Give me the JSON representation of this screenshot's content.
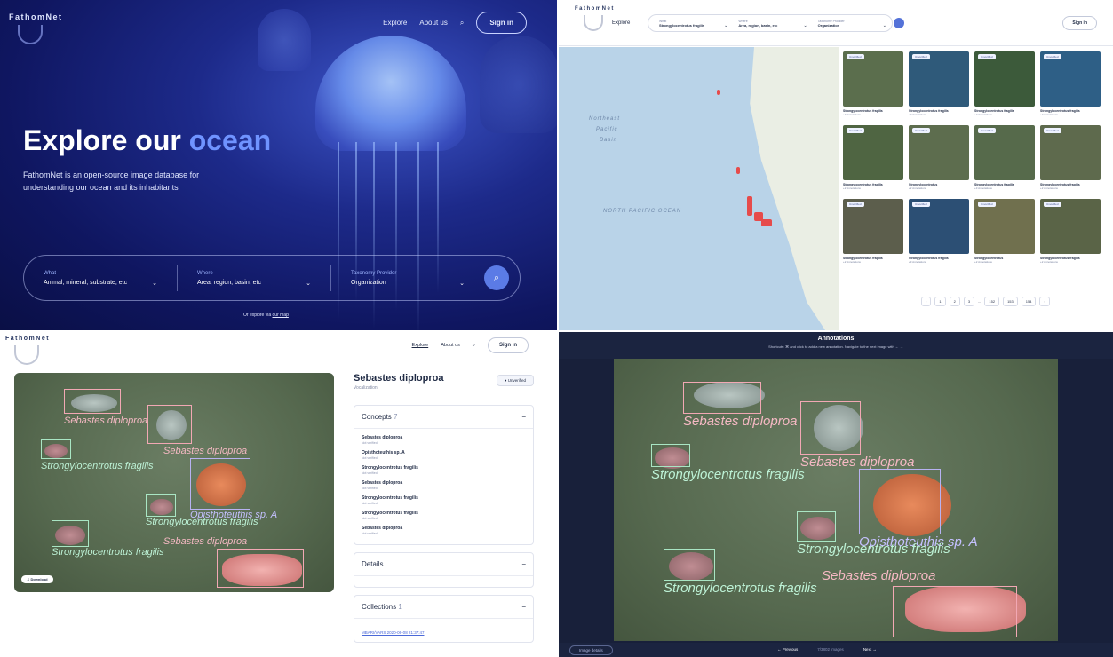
{
  "brand": "FathomNet",
  "hero": {
    "nav": {
      "explore": "Explore",
      "about": "About us",
      "sign_in": "Sign in"
    },
    "title_main": "Explore our ",
    "title_accent": "ocean",
    "subtitle": "FathomNet is an open-source image database for understanding our ocean and its inhabitants",
    "search": {
      "what_label": "What",
      "what_placeholder": "Animal, mineral, substrate, etc",
      "where_label": "Where",
      "where_placeholder": "Area, region, basin, etc",
      "taxonomy_label": "Taxonomy Provider",
      "taxonomy_value": "Organization"
    },
    "footer_prefix": "Or explore via ",
    "footer_link": "our map"
  },
  "explore": {
    "nav_explore": "Explore",
    "search": {
      "what_label": "What",
      "what_value": "Strongylocentrotus fragilis",
      "where_label": "Where",
      "where_value": "Area, region, basin, etc",
      "taxonomy_label": "Taxonomy Provider",
      "taxonomy_value": "Organization"
    },
    "sign_in": "Sign in",
    "map_labels": {
      "northeast": "Northeast",
      "pacific": "Pacific",
      "basin": "Basin",
      "ocean": "NORTH PACIFIC OCEAN"
    },
    "results": [
      {
        "tag": "Unverified",
        "name": "Strongylocentrotus fragilis",
        "meta": "+3 Annotations",
        "color": "#5b6e4d"
      },
      {
        "tag": "Unverified",
        "name": "Strongylocentrotus fragilis",
        "meta": "+2 Annotations",
        "color": "#2f5a7a"
      },
      {
        "tag": "Unverified",
        "name": "Strongylocentrotus fragilis",
        "meta": "+2 Annotations",
        "color": "#3c5a3a"
      },
      {
        "tag": "Unverified",
        "name": "Strongylocentrotus fragilis",
        "meta": "+2 Annotations",
        "color": "#2e5f86"
      },
      {
        "tag": "Unverified",
        "name": "Strongylocentrotus fragilis",
        "meta": "+2 Annotations",
        "color": "#4f6542"
      },
      {
        "tag": "Unverified",
        "name": "Strongylocentrotus",
        "meta": "+2 Annotations",
        "color": "#5d6d4e"
      },
      {
        "tag": "Unverified",
        "name": "Strongylocentrotus fragilis",
        "meta": "+3 Annotations",
        "color": "#566a4b"
      },
      {
        "tag": "Unverified",
        "name": "Strongylocentrotus fragilis",
        "meta": "+2 Annotations",
        "color": "#5e6a4d"
      },
      {
        "tag": "Unverified",
        "name": "Strongylocentrotus fragilis",
        "meta": "+2 Annotations",
        "color": "#5c5e4c"
      },
      {
        "tag": "Unverified",
        "name": "Strongylocentrotus fragilis",
        "meta": "+3 Annotations",
        "color": "#2c4f74"
      },
      {
        "tag": "Unverified",
        "name": "Strongylocentrotus",
        "meta": "+2 Annotations",
        "color": "#70704e"
      },
      {
        "tag": "Unverified",
        "name": "Strongylocentrotus fragilis",
        "meta": "+2 Annotations",
        "color": "#5a6447"
      }
    ],
    "pager": {
      "prev": "‹",
      "p1": "1",
      "p2": "2",
      "p3": "3",
      "ellipsis": "...",
      "p152": "152",
      "p153": "153",
      "p154": "154",
      "next": "›"
    }
  },
  "detail": {
    "nav": {
      "explore": "Explore",
      "about": "About us",
      "sign_in": "Sign in"
    },
    "title": "Sebastes diploproa",
    "subtitle": "Vocalization",
    "status": "Unverified",
    "download": "Download",
    "concepts_title": "Concepts",
    "concepts_count": "7",
    "concepts": [
      {
        "name": "Sebastes diploproa",
        "status": "Not verified"
      },
      {
        "name": "Opisthoteuthis sp. A",
        "status": "Not verified"
      },
      {
        "name": "Strongylocentrotus fragilis",
        "status": "Not verified"
      },
      {
        "name": "Sebastes diploproa",
        "status": "Not verified"
      },
      {
        "name": "Strongylocentrotus fragilis",
        "status": "Not verified"
      },
      {
        "name": "Strongylocentrotus fragilis",
        "status": "Not verified"
      },
      {
        "name": "Sebastes diploproa",
        "status": "Not verified"
      }
    ],
    "details_title": "Details",
    "collections_title": "Collections",
    "collections_count": "1",
    "collection_link": "MBARI/VARS 2020-06-08 21:37:47",
    "labels": {
      "seb1": "Sebastes diploproa",
      "seb2": "Sebastes diploproa",
      "seb3": "Sebastes diploproa",
      "str1": "Strongylocentrotus fragilis",
      "str2": "Strongylocentrotus fragilis",
      "str3": "Strongylocentrotus fragilis",
      "opi": "Opisthoteuthis sp. A"
    }
  },
  "annotate": {
    "title": "Annotations",
    "hint": "Shortcuts: ⌘ and click to add a new annotation. Navigate to the next image with ← →",
    "image_details": "Image details",
    "previous": "Previous",
    "count": "7/3802 images",
    "next": "Next"
  }
}
